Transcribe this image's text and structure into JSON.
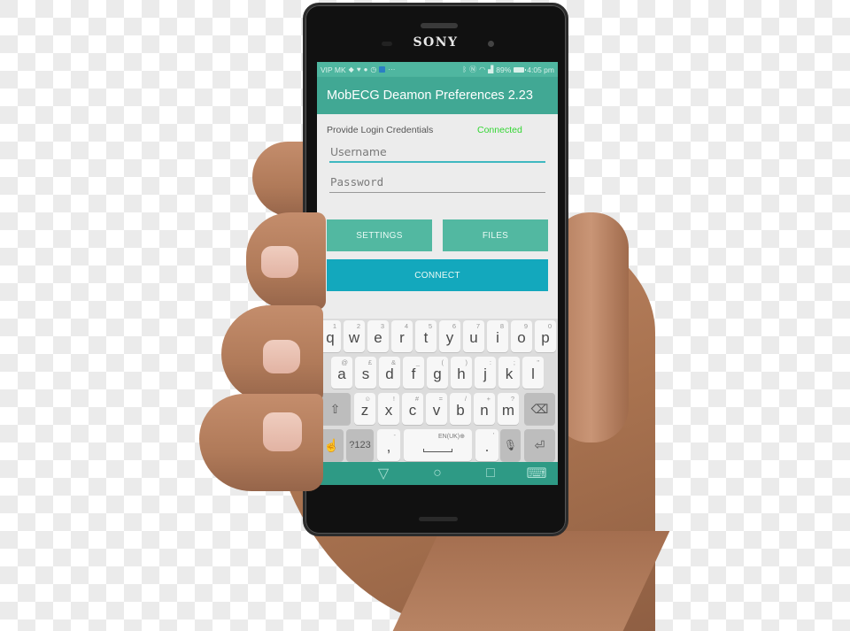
{
  "device": {
    "brand": "SONY"
  },
  "status_bar": {
    "carrier": "VIP MK",
    "left_icons": [
      "diamond-icon",
      "heart-icon",
      "chat-icon",
      "clock-icon",
      "app-badge-icon",
      "more-icon"
    ],
    "more_glyph": "···",
    "right_icons": [
      "bluetooth-icon",
      "nfc-icon",
      "wifi-icon",
      "signal-icon"
    ],
    "battery": "89%",
    "time": "4:05 pm"
  },
  "app_bar": {
    "title": "MobECG Deamon Preferences 2.23"
  },
  "form": {
    "credentials_label": "Provide Login Credentials",
    "connection_status": "Connected",
    "connection_status_color": "#33d633",
    "username": {
      "value": "",
      "placeholder": "Username"
    },
    "password": {
      "value": "",
      "placeholder": "Password"
    }
  },
  "buttons": {
    "settings": "SETTINGS",
    "files": "FILES",
    "connect": "CONNECT"
  },
  "keyboard": {
    "row1": [
      {
        "k": "q",
        "h": "1"
      },
      {
        "k": "w",
        "h": "2"
      },
      {
        "k": "e",
        "h": "3"
      },
      {
        "k": "r",
        "h": "4"
      },
      {
        "k": "t",
        "h": "5"
      },
      {
        "k": "y",
        "h": "6"
      },
      {
        "k": "u",
        "h": "7"
      },
      {
        "k": "i",
        "h": "8"
      },
      {
        "k": "o",
        "h": "9"
      },
      {
        "k": "p",
        "h": "0"
      }
    ],
    "row2": [
      {
        "k": "a",
        "h": "@"
      },
      {
        "k": "s",
        "h": "£"
      },
      {
        "k": "d",
        "h": "&"
      },
      {
        "k": "f",
        "h": "_"
      },
      {
        "k": "g",
        "h": "("
      },
      {
        "k": "h",
        "h": ")"
      },
      {
        "k": "j",
        "h": ":"
      },
      {
        "k": "k",
        "h": ";"
      },
      {
        "k": "l",
        "h": "\""
      }
    ],
    "row3": [
      {
        "k": "z",
        "h": "☺"
      },
      {
        "k": "x",
        "h": "!"
      },
      {
        "k": "c",
        "h": "#"
      },
      {
        "k": "v",
        "h": "="
      },
      {
        "k": "b",
        "h": "/"
      },
      {
        "k": "n",
        "h": "+"
      },
      {
        "k": "m",
        "h": "?"
      }
    ],
    "symbols_key": "?123",
    "comma_key": ",",
    "comma_hint": "-",
    "space_language": "EN(UK)⊕",
    "period_key": ".",
    "period_hint": "'",
    "shift_glyph": "⇧",
    "backspace_glyph": "⌫",
    "enter_glyph": "⏎",
    "mic_glyph": "🎙",
    "gesture_glyph": "☝"
  },
  "nav_bar": {
    "back_glyph": "▽",
    "home_glyph": "○",
    "recents_glyph": "□",
    "keyboard_glyph": "⌨"
  }
}
